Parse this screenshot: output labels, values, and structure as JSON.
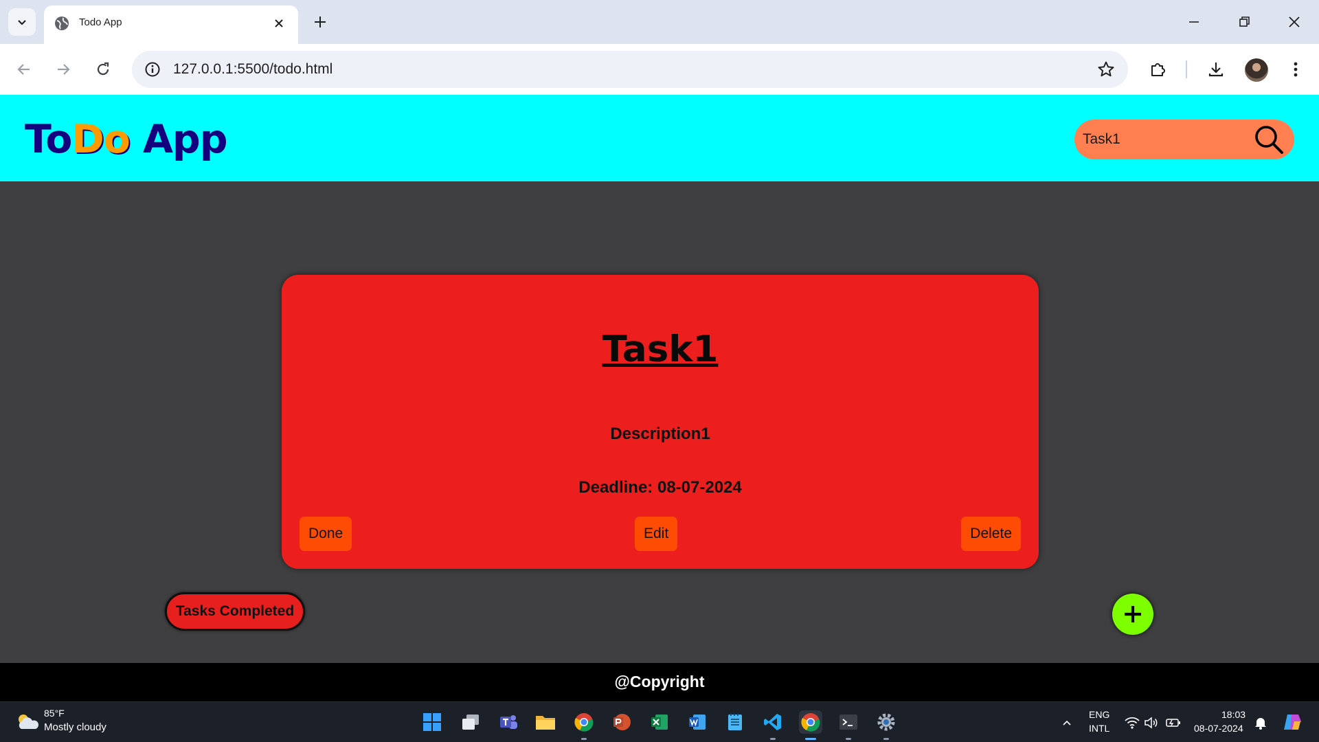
{
  "browser": {
    "tab": {
      "title": "Todo App"
    },
    "url": "127.0.0.1:5500/todo.html"
  },
  "app": {
    "logo_part1": "To",
    "logo_part2": "Do",
    "logo_part3": " App",
    "search": {
      "value": "Task1"
    }
  },
  "task": {
    "title": "Task1",
    "description": "Description1",
    "deadline_label": "Deadline: ",
    "deadline_value": "08-07-2024",
    "buttons": {
      "done": "Done",
      "edit": "Edit",
      "delete": "Delete"
    }
  },
  "tasks_completed_label": "Tasks Completed",
  "footer": {
    "text": "@Copyright"
  },
  "taskbar": {
    "weather": {
      "temp": "85°F",
      "condition": "Mostly cloudy"
    },
    "language": {
      "line1": "ENG",
      "line2": "INTL"
    },
    "clock": {
      "time": "18:03",
      "date": "08-07-2024"
    }
  },
  "colors": {
    "header_bg": "#00ffff",
    "logo_blue": "#15007e",
    "logo_orange": "#ff9a00",
    "search_bg": "#ff7f50",
    "page_bg": "#3f3f41",
    "card_bg": "#ec1e1e",
    "card_button_bg": "#ff4c05",
    "add_button_bg": "#7dff00",
    "footer_bg": "#000000"
  },
  "icons": {
    "tab_search": "chevron-down-icon",
    "favicon": "globe-icon",
    "search": "magnifier-icon",
    "add": "plus-icon"
  }
}
